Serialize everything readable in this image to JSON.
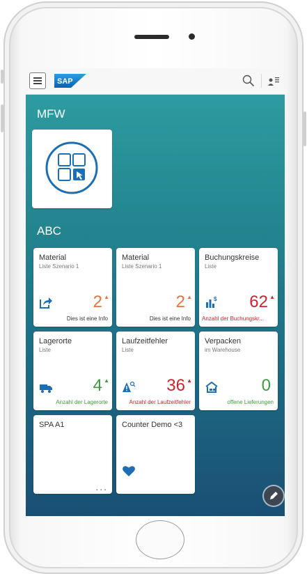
{
  "shell": {
    "logo_text": "SAP"
  },
  "groups": [
    {
      "title": "MFW"
    },
    {
      "title": "ABC"
    }
  ],
  "tiles": [
    {
      "title": "Material",
      "subtitle": "Liste Szenario 1",
      "icon": "share-icon",
      "value": "2",
      "trend": "up",
      "value_color": "#e8743b",
      "footer": "Dies ist eine Info",
      "footer_color": "#333333"
    },
    {
      "title": "Material",
      "subtitle": "Liste Szenario 1",
      "icon": "",
      "value": "2",
      "trend": "up",
      "value_color": "#e8743b",
      "footer": "Dies ist eine Info",
      "footer_color": "#333333"
    },
    {
      "title": "Buchungskreise",
      "subtitle": "Liste",
      "icon": "bar-chart-dollar-icon",
      "value": "62",
      "trend": "up",
      "value_color": "#d0222e",
      "footer": "Anzahl der Buchungskr...",
      "footer_color": "#d0222e"
    },
    {
      "title": "Lagerorte",
      "subtitle": "Liste",
      "icon": "truck-icon",
      "value": "4",
      "trend": "up",
      "value_color": "#3f9b3f",
      "footer": "Anzahl der Lagerorte",
      "footer_color": "#3f9b3f"
    },
    {
      "title": "Laufzeitfehler",
      "subtitle": "Liste",
      "icon": "warning-search-icon",
      "value": "36",
      "trend": "up",
      "value_color": "#d0222e",
      "footer": "Anzahl der Laufzeitfehler",
      "footer_color": "#d0222e"
    },
    {
      "title": "Verpacken",
      "subtitle": "im Warehouse",
      "icon": "warehouse-icon",
      "value": "0",
      "trend": "",
      "value_color": "#3f9b3f",
      "footer": "offene Lieferungen",
      "footer_color": "#3f9b3f"
    },
    {
      "title": "SPA A1",
      "subtitle": "",
      "icon": "",
      "value": "",
      "trend": "",
      "value_color": "#333333",
      "footer": "...",
      "footer_color": "#666666"
    },
    {
      "title": "Counter Demo <3",
      "subtitle": "",
      "icon": "heart-icon",
      "value": "",
      "trend": "",
      "value_color": "#333333",
      "footer": "",
      "footer_color": "#333333"
    }
  ],
  "colors": {
    "brand": "#1c75bc",
    "icon_blue": "#1c6fb5"
  }
}
